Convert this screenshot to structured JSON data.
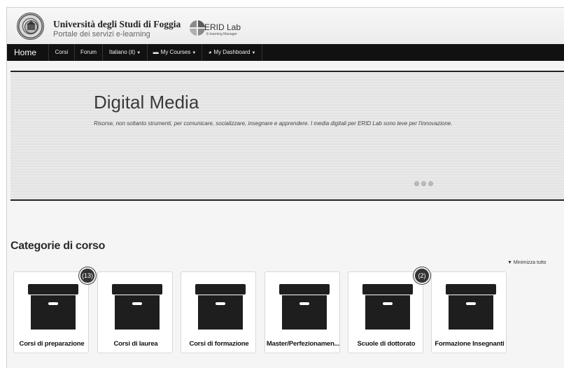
{
  "header": {
    "university_name": "Università degli Studi di Foggia",
    "subtitle": "Portale dei servizi e-learning",
    "partner_logo_text": "ERID Lab",
    "partner_logo_tagline": "E-learning Manager"
  },
  "navbar": {
    "home": "Home",
    "courses": "Corsi",
    "forum": "Forum",
    "language": "Italiano (it)",
    "my_courses": "My Courses",
    "my_dashboard": "My Dashboard"
  },
  "slider": {
    "title": "Digital Media",
    "text": "Risorse, non soltanto strumenti, per comunicare, socializzare, insegnare e apprendere. I media digitali per ERID Lab sono leve per l'innovazione.",
    "slide_count": 3
  },
  "categories": {
    "title": "Categorie di corso",
    "collapse_all": "Minimizza tutto",
    "items": [
      {
        "label": "Corsi di preparazione",
        "badge": "(13)"
      },
      {
        "label": "Corsi di laurea",
        "badge": ""
      },
      {
        "label": "Corsi di formazione",
        "badge": ""
      },
      {
        "label": "Master/Perfezionamen...",
        "badge": ""
      },
      {
        "label": "Scuole di dottorato",
        "badge": "(2)"
      },
      {
        "label": "Formazione Insegnanti",
        "badge": ""
      }
    ]
  },
  "icons": {
    "my_courses": "briefcase-icon",
    "my_dashboard": "dashboard-icon",
    "category": "archive-box-icon",
    "collapse": "triangle-down-icon"
  },
  "colors": {
    "navbar": "#111111",
    "background": "#f4f4f4",
    "box": "#1e1e1e"
  }
}
